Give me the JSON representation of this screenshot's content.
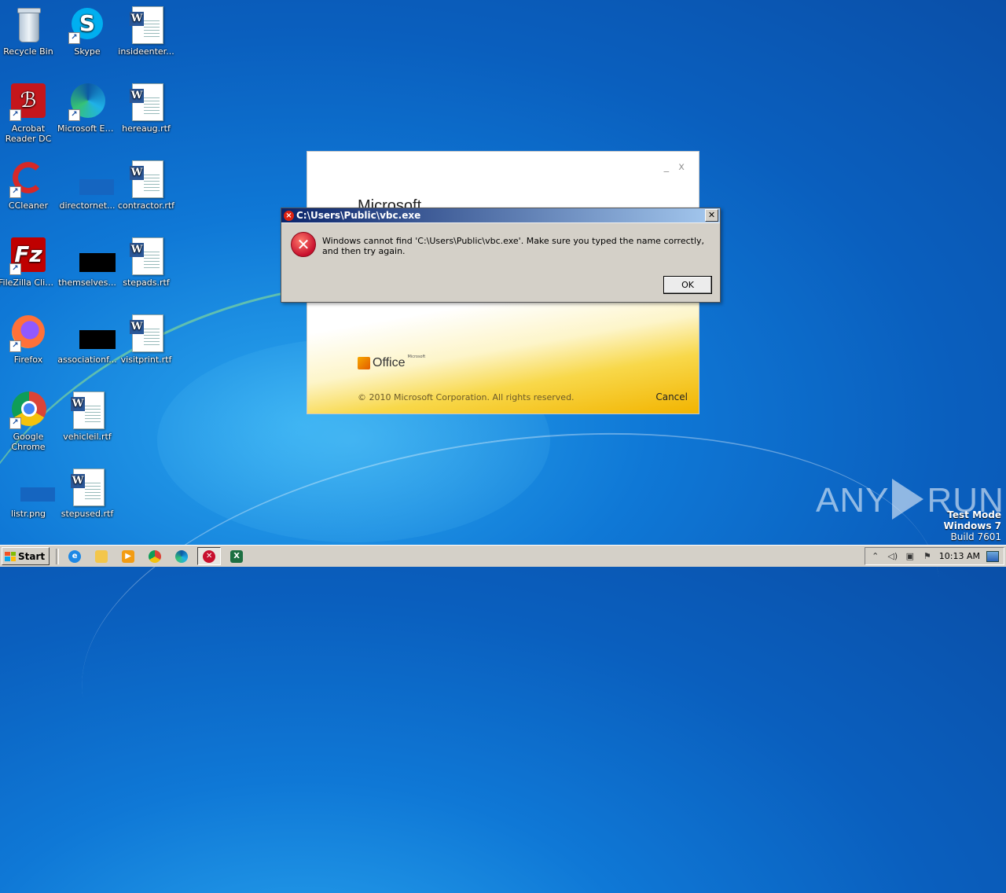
{
  "desktop": {
    "icons": [
      {
        "label": "Recycle Bin"
      },
      {
        "label": "Skype"
      },
      {
        "label": "insideenter..."
      },
      {
        "label": "Acrobat Reader DC"
      },
      {
        "label": "Microsoft Edge"
      },
      {
        "label": "hereaug.rtf"
      },
      {
        "label": "CCleaner"
      },
      {
        "label": "directornet..."
      },
      {
        "label": "contractor.rtf"
      },
      {
        "label": "FileZilla Client"
      },
      {
        "label": "themselves..."
      },
      {
        "label": "stepads.rtf"
      },
      {
        "label": "Firefox"
      },
      {
        "label": "associationf..."
      },
      {
        "label": "visitprint.rtf"
      },
      {
        "label": "Google Chrome"
      },
      {
        "label": "vehicleil.rtf"
      },
      {
        "label": "listr.png"
      },
      {
        "label": "stepused.rtf"
      }
    ]
  },
  "splash": {
    "title": "Microsoft",
    "controls": "_ x",
    "logo_text": "Office",
    "logo_small": "Microsoft",
    "copyright": "© 2010 Microsoft Corporation.  All rights reserved.",
    "cancel_label": "Cancel"
  },
  "dialog": {
    "title": "C:\\Users\\Public\\vbc.exe",
    "message": "Windows cannot find 'C:\\Users\\Public\\vbc.exe'. Make sure you typed the name correctly, and then try again.",
    "ok_label": "OK",
    "close_glyph": "✕"
  },
  "watermark": {
    "left": "ANY",
    "right": "RUN"
  },
  "testmode": {
    "line1": "Test Mode",
    "line2": "Windows 7",
    "line3": "Build 7601"
  },
  "taskbar": {
    "start_label": "Start",
    "clock": "10:13 AM"
  }
}
